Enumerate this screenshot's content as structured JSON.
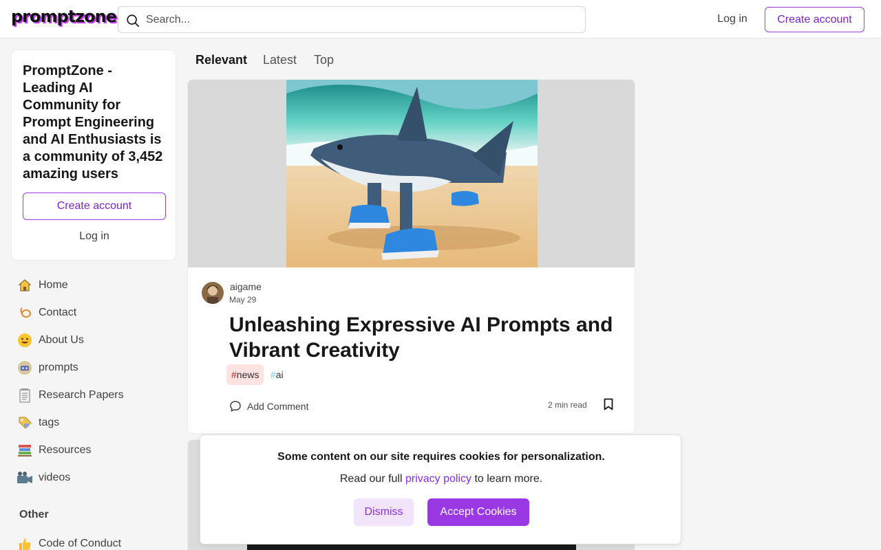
{
  "header": {
    "logo": "promptzone.",
    "search_placeholder": "Search...",
    "login_label": "Log in",
    "create_account_label": "Create account"
  },
  "welcome": {
    "heading": "PromptZone - Leading AI Community for Prompt Engineering and AI Enthusiasts is a community of 3,452 amazing users",
    "create_account_label": "Create account",
    "login_label": "Log in"
  },
  "sidebar": {
    "items": [
      {
        "label": "Home",
        "icon": "house-icon"
      },
      {
        "label": "Contact",
        "icon": "lasso-icon"
      },
      {
        "label": "About Us",
        "icon": "smiling-face-icon"
      },
      {
        "label": "prompts",
        "icon": "robot-icon"
      },
      {
        "label": "Research Papers",
        "icon": "notepad-icon"
      },
      {
        "label": "tags",
        "icon": "label-tag-icon"
      },
      {
        "label": "Resources",
        "icon": "books-icon"
      },
      {
        "label": "videos",
        "icon": "video-camera-icon"
      }
    ],
    "other_heading": "Other",
    "other_items": [
      {
        "label": "Code of Conduct",
        "icon": "thumbs-up-icon"
      }
    ]
  },
  "feed": {
    "tabs": [
      "Relevant",
      "Latest",
      "Top"
    ],
    "active_tab": "Relevant",
    "post": {
      "author": "aigame",
      "date": "May 29",
      "title": "Unleashing Expressive AI Prompts and Vibrant Creativity",
      "tags": [
        {
          "hash": "#",
          "name": "news"
        },
        {
          "hash": "#",
          "name": "ai"
        }
      ],
      "comment_label": "Add Comment",
      "read_time": "2 min read"
    }
  },
  "cookie_banner": {
    "message": "Some content on our site requires cookies for personalization.",
    "sub_prefix": "Read our full ",
    "link_text": "privacy policy",
    "sub_suffix": " to learn more.",
    "dismiss_label": "Dismiss",
    "accept_label": "Accept Cookies"
  },
  "colors": {
    "accent": "#9a38e4",
    "accent_light": "#f2e4fb",
    "news_tag_bg": "#fde2e2",
    "news_hash": "#c3272b",
    "ai_hash": "#7fc8f0"
  }
}
